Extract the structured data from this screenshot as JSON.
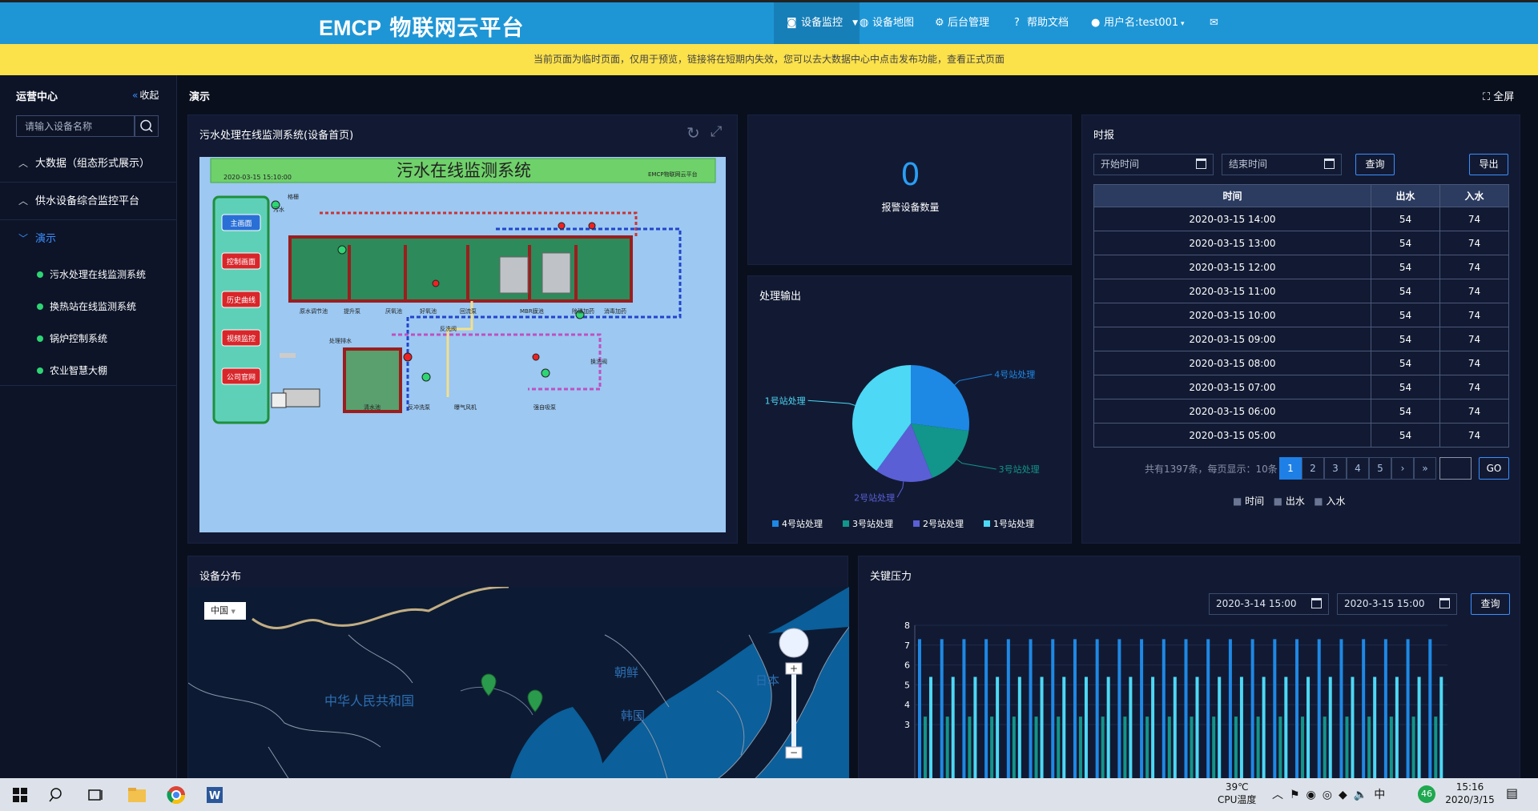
{
  "nav": {
    "logo_prefix": "EMCP",
    "logo_suffix": " 物联网云平台",
    "items": [
      {
        "label": "设备监控",
        "icon": "monitor-icon"
      },
      {
        "label": "设备地图",
        "icon": "globe-icon"
      },
      {
        "label": "后台管理",
        "icon": "gear-icon"
      },
      {
        "label": "帮助文档",
        "icon": "help-icon"
      },
      {
        "label": "用户名:test001",
        "icon": "user-icon"
      }
    ],
    "mail_icon": "mail-icon"
  },
  "notice": "当前页面为临时页面，仅用于预览，链接将在短期内失效，您可以去大数据中心中点击发布功能，查看正式页面",
  "sidebar": {
    "title": "运营中心",
    "collapse": "收起",
    "search_placeholder": "请输入设备名称",
    "groups": [
      {
        "label": "大数据（组态形式展示）"
      },
      {
        "label": "供水设备综合监控平台"
      },
      {
        "label": "演示"
      }
    ],
    "subitems": [
      {
        "label": "污水处理在线监测系统"
      },
      {
        "label": "换热站在线监测系统"
      },
      {
        "label": "锅炉控制系统"
      },
      {
        "label": "农业智慧大棚"
      }
    ]
  },
  "page": {
    "title": "演示",
    "fullscreen": "全屏"
  },
  "panel_sewage": {
    "title": "污水处理在线监测系统(设备首页)",
    "scada_title": "污水在线监测系统",
    "scada_time": "2020-03-15 15:10:00",
    "scada_brand": "EMCP物联网云平台",
    "buttons": [
      "主画面",
      "控制画面",
      "历史曲线",
      "视频监控",
      "公司官网"
    ],
    "labels": [
      "污水",
      "格栅",
      "原水调节池",
      "提升泵",
      "厌氧池",
      "好氧池",
      "回流泵",
      "MBR膜池",
      "除磷加药",
      "消毒加药",
      "反洗阀",
      "处理排水",
      "清水池",
      "反冲洗泵",
      "曝气风机",
      "强自吸泵",
      "换洗阀"
    ]
  },
  "panel_alarm": {
    "value": "0",
    "label": "报警设备数量"
  },
  "panel_pie": {
    "title": "处理输出",
    "legend": [
      {
        "name": "4号站处理",
        "color": "#1e88e5"
      },
      {
        "name": "3号站处理",
        "color": "#12958a"
      },
      {
        "name": "2号站处理",
        "color": "#5a5fd6"
      },
      {
        "name": "1号站处理",
        "color": "#4dd8f5"
      }
    ]
  },
  "chart_data": [
    {
      "type": "pie",
      "title": "处理输出",
      "categories": [
        "4号站处理",
        "3号站处理",
        "2号站处理",
        "1号站处理"
      ],
      "values": [
        27,
        17,
        16,
        40
      ]
    },
    {
      "type": "bar",
      "title": "关键压力",
      "ylim": [
        3,
        8
      ],
      "yticks": [
        3,
        4,
        5,
        6,
        7,
        8
      ],
      "series": [
        {
          "color": "#1e88e5",
          "values": [
            7.3,
            7.3,
            7.3,
            7.3,
            7.3,
            7.3,
            7.3,
            7.3,
            7.3,
            7.3,
            7.3,
            7.3,
            7.3,
            7.3,
            7.3,
            7.3,
            7.3,
            7.3,
            7.3,
            7.3,
            7.3,
            7.3,
            7.3,
            7.3
          ]
        },
        {
          "color": "#12958a",
          "values": [
            3.4,
            3.4,
            3.4,
            3.4,
            3.4,
            3.4,
            3.4,
            3.4,
            3.4,
            3.4,
            3.4,
            3.4,
            3.4,
            3.4,
            3.4,
            3.4,
            3.4,
            3.4,
            3.4,
            3.4,
            3.4,
            3.4,
            3.4,
            3.4
          ]
        },
        {
          "color": "#4dd8f5",
          "values": [
            5.4,
            5.4,
            5.4,
            5.4,
            5.4,
            5.4,
            5.4,
            5.4,
            5.4,
            5.4,
            5.4,
            5.4,
            5.4,
            5.4,
            5.4,
            5.4,
            5.4,
            5.4,
            5.4,
            5.4,
            5.4,
            5.4,
            5.4,
            5.4
          ]
        }
      ]
    }
  ],
  "panel_report": {
    "title": "时报",
    "start_placeholder": "开始时间",
    "end_placeholder": "结束时间",
    "query": "查询",
    "export": "导出",
    "headers": [
      "时间",
      "出水",
      "入水"
    ],
    "rows": [
      [
        "2020-03-15 14:00",
        "54",
        "74"
      ],
      [
        "2020-03-15 13:00",
        "54",
        "74"
      ],
      [
        "2020-03-15 12:00",
        "54",
        "74"
      ],
      [
        "2020-03-15 11:00",
        "54",
        "74"
      ],
      [
        "2020-03-15 10:00",
        "54",
        "74"
      ],
      [
        "2020-03-15 09:00",
        "54",
        "74"
      ],
      [
        "2020-03-15 08:00",
        "54",
        "74"
      ],
      [
        "2020-03-15 07:00",
        "54",
        "74"
      ],
      [
        "2020-03-15 06:00",
        "54",
        "74"
      ],
      [
        "2020-03-15 05:00",
        "54",
        "74"
      ]
    ],
    "pager_info": "共有1397条，每页显示：10条",
    "pages": [
      "1",
      "2",
      "3",
      "4",
      "5",
      "›",
      "»"
    ],
    "go": "GO",
    "legend": [
      "时间",
      "出水",
      "入水"
    ]
  },
  "panel_map": {
    "title": "设备分布",
    "region": "中国",
    "labels": [
      "中华人民共和国",
      "朝鲜",
      "韩国",
      "日本"
    ]
  },
  "panel_pressure": {
    "title": "关键压力",
    "start": "2020-3-14 15:00",
    "end": "2020-3-15 15:00",
    "query": "查询"
  },
  "taskbar": {
    "temp": "39℃",
    "temp_label": "CPU温度",
    "ime": "中",
    "badge": "46",
    "time": "15:16",
    "date": "2020/3/15"
  }
}
